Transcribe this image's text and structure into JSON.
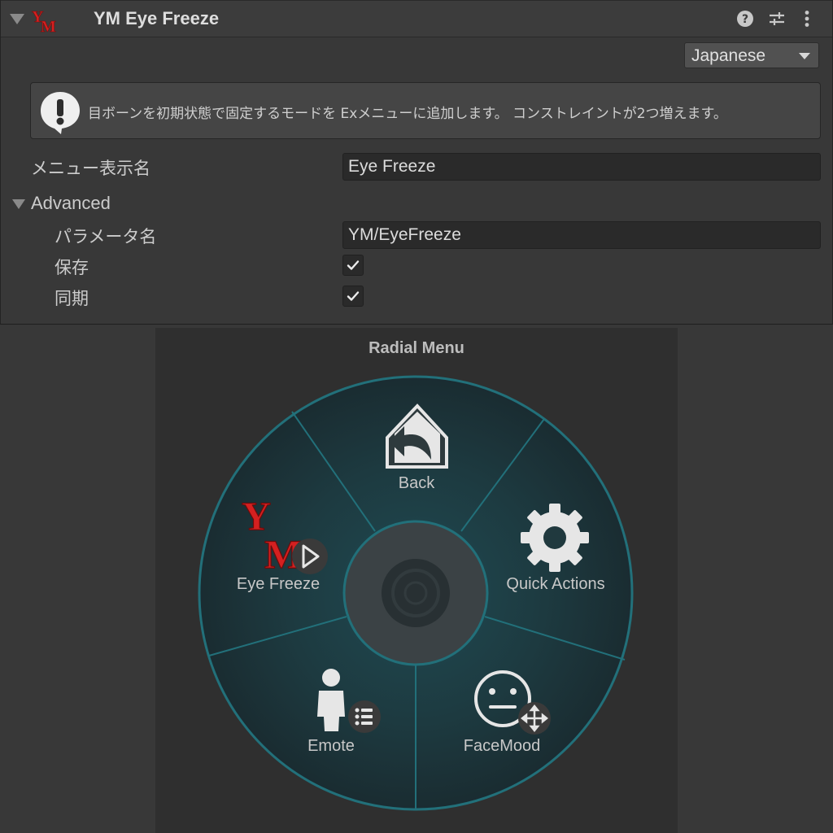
{
  "inspector": {
    "component_title": "YM Eye Freeze",
    "language": "Japanese",
    "help_message": "目ボーンを初期状態で固定するモードを Exメニューに追加します。 コンストレイントが2つ増えます。",
    "menu_name_label": "メニュー表示名",
    "menu_name_value": "Eye Freeze",
    "advanced_label": "Advanced",
    "param_name_label": "パラメータ名",
    "param_name_value": "YM/EyeFreeze",
    "saved_label": "保存",
    "saved_checked": true,
    "synced_label": "同期",
    "synced_checked": true
  },
  "radial_menu": {
    "title": "Radial Menu",
    "items": [
      {
        "label": "Back",
        "icon": "back-home-icon"
      },
      {
        "label": "Quick Actions",
        "icon": "gear-icon"
      },
      {
        "label": "FaceMood",
        "icon": "neutral-face-icon"
      },
      {
        "label": "Emote",
        "icon": "person-icon"
      },
      {
        "label": "Eye Freeze",
        "icon": "ym-logo-icon"
      }
    ]
  },
  "colors": {
    "logo_red": "#d42020",
    "radial_ring": "#1f6e78",
    "radial_fill": "#1e3a40"
  }
}
